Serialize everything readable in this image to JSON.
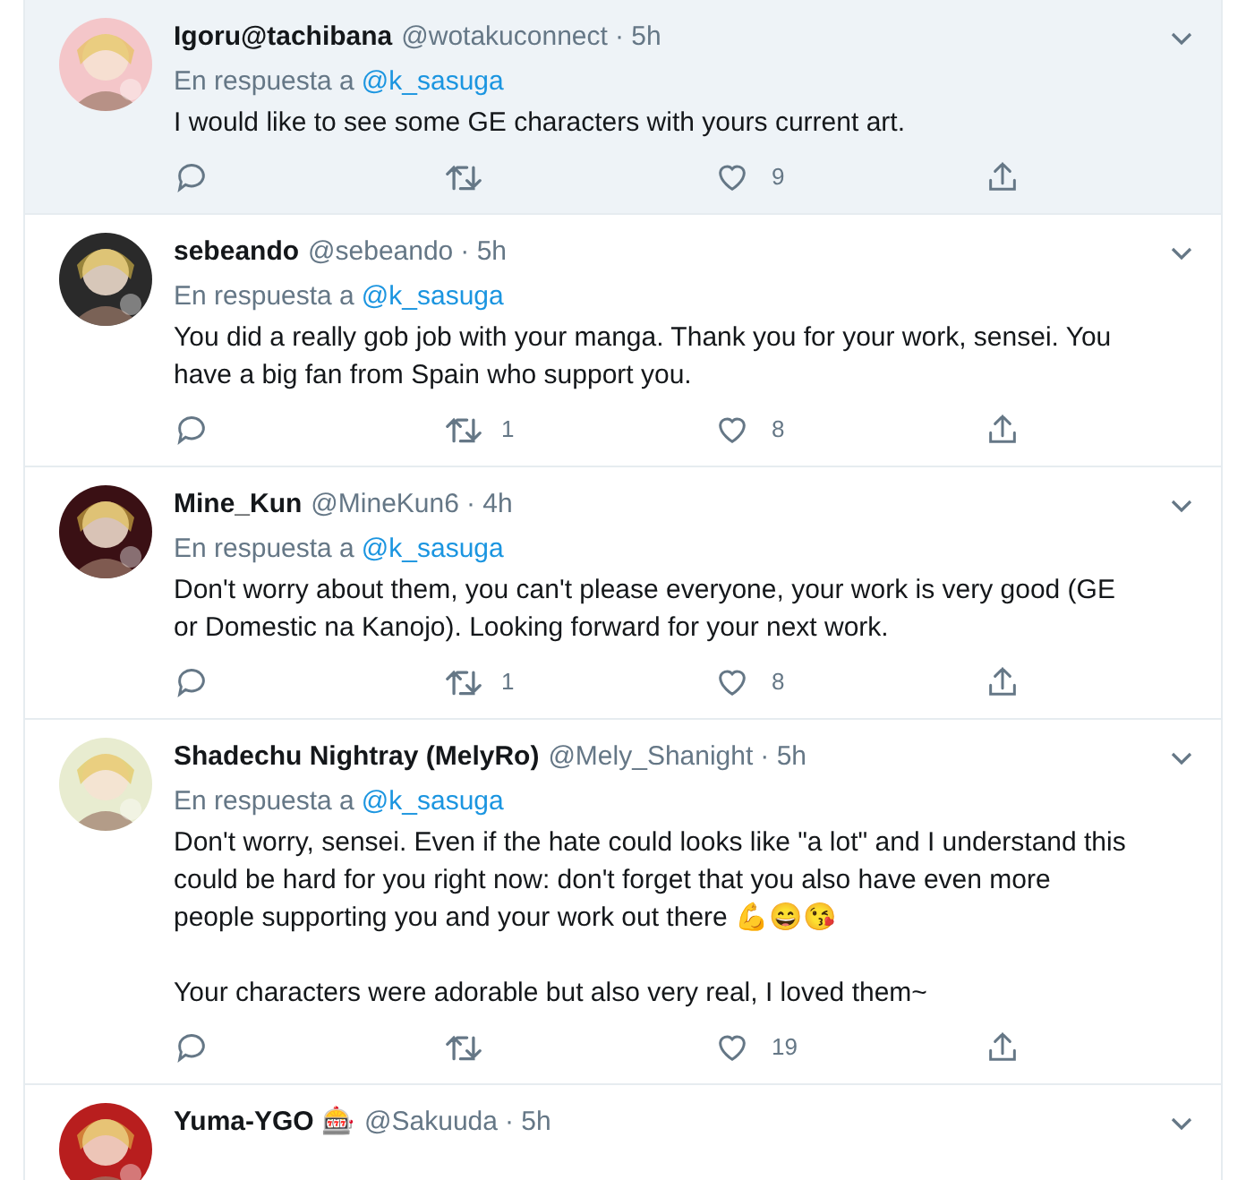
{
  "tweets": [
    {
      "name": "Igoru@tachibana",
      "handle": "@wotakuconnect",
      "time": "· 5h",
      "reply_prefix": "En respuesta a",
      "reply_to": "@k_sasuga",
      "highlighted": true,
      "paragraphs": [
        "I would like to see some GE characters with yours current art."
      ],
      "likes": "9"
    },
    {
      "name": "sebeando",
      "handle": "@sebeando",
      "time": "· 5h",
      "reply_prefix": "En respuesta a",
      "reply_to": "@k_sasuga",
      "highlighted": false,
      "paragraphs": [
        "You did a really gob job with your manga. Thank you for your work, sensei. You have a big fan from Spain who support you."
      ],
      "retweets": "1",
      "likes": "8"
    },
    {
      "name": "Mine_Kun",
      "handle": "@MineKun6",
      "time": "· 4h",
      "reply_prefix": "En respuesta a",
      "reply_to": "@k_sasuga",
      "highlighted": false,
      "paragraphs": [
        "Don't worry about them, you can't please everyone, your work is very good (GE or Domestic na Kanojo). Looking forward for your next work."
      ],
      "retweets": "1",
      "likes": "8"
    },
    {
      "name": "Shadechu Nightray (MelyRo)",
      "handle": "@Mely_Shanight",
      "time": "· 5h",
      "reply_prefix": "En respuesta a",
      "reply_to": "@k_sasuga",
      "highlighted": false,
      "paragraphs": [
        "Don't worry, sensei. Even if the hate could looks like \"a lot\" and I understand this could be hard for you right now: don't forget that you also have even more people supporting you and your work out there 💪😄😘",
        "Your characters were adorable but also very real, I loved them~"
      ],
      "likes": "19"
    },
    {
      "name": "Yuma-YGO 🎰",
      "handle": "@Sakuuda",
      "time": "· 5h",
      "highlighted": false
    }
  ]
}
